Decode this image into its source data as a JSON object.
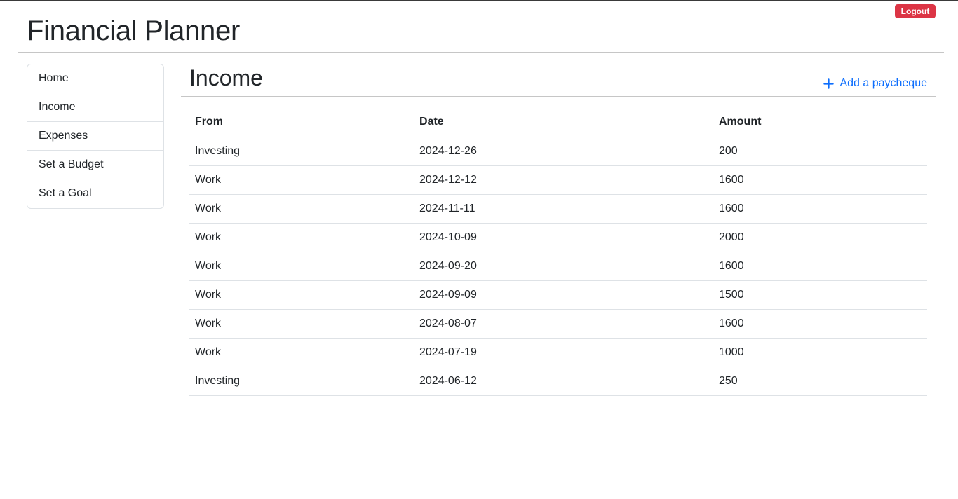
{
  "header": {
    "title": "Financial Planner",
    "logout_label": "Logout"
  },
  "sidebar": {
    "items": [
      {
        "label": "Home"
      },
      {
        "label": "Income"
      },
      {
        "label": "Expenses"
      },
      {
        "label": "Set a Budget"
      },
      {
        "label": "Set a Goal"
      }
    ]
  },
  "main": {
    "title": "Income",
    "add_label": "Add a paycheque",
    "add_icon": "plus-icon",
    "table": {
      "columns": [
        "From",
        "Date",
        "Amount"
      ],
      "rows": [
        {
          "from": "Investing",
          "date": "2024-12-26",
          "amount": "200"
        },
        {
          "from": "Work",
          "date": "2024-12-12",
          "amount": "1600"
        },
        {
          "from": "Work",
          "date": "2024-11-11",
          "amount": "1600"
        },
        {
          "from": "Work",
          "date": "2024-10-09",
          "amount": "2000"
        },
        {
          "from": "Work",
          "date": "2024-09-20",
          "amount": "1600"
        },
        {
          "from": "Work",
          "date": "2024-09-09",
          "amount": "1500"
        },
        {
          "from": "Work",
          "date": "2024-08-07",
          "amount": "1600"
        },
        {
          "from": "Work",
          "date": "2024-07-19",
          "amount": "1000"
        },
        {
          "from": "Investing",
          "date": "2024-06-12",
          "amount": "250"
        }
      ]
    }
  },
  "colors": {
    "logout_bg": "#dc3545",
    "link": "#0d6efd",
    "text": "#212529",
    "border": "#dee2e6"
  }
}
